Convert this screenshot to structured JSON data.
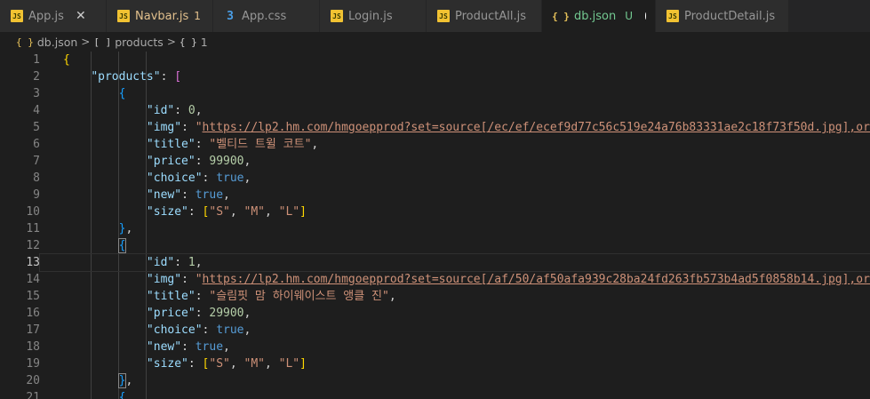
{
  "tabs": [
    {
      "name": "App.js",
      "type": "js",
      "badge": "",
      "close": "✕",
      "state": ""
    },
    {
      "name": "Navbar.js",
      "type": "js",
      "badge": "1",
      "close": "",
      "state": "mod"
    },
    {
      "name": "App.css",
      "type": "css",
      "badge": "",
      "close": "",
      "state": ""
    },
    {
      "name": "Login.js",
      "type": "js",
      "badge": "",
      "close": "",
      "state": ""
    },
    {
      "name": "ProductAll.js",
      "type": "js",
      "badge": "",
      "close": "",
      "state": ""
    },
    {
      "name": "db.json",
      "type": "json",
      "badge": "U",
      "close": "",
      "state": "untracked"
    },
    {
      "name": "ProductDetail.js",
      "type": "js",
      "badge": "",
      "close": "",
      "state": ""
    }
  ],
  "tab_icons": {
    "js": "JS",
    "css": "3",
    "json": "{ }"
  },
  "breadcrumb": {
    "file_icon": "{ }",
    "file": "db.json",
    "sep": ">",
    "array_icon": "[ ]",
    "array": "products",
    "object_icon": "{ }",
    "object": "1"
  },
  "editor": {
    "lines": [
      {
        "n": "1",
        "code": [
          [
            "{",
            "b1"
          ]
        ]
      },
      {
        "n": "2",
        "code": [
          [
            "    ",
            ""
          ],
          [
            "\"products\"",
            "key"
          ],
          [
            ": ",
            "punc"
          ],
          [
            "[",
            "b2"
          ]
        ]
      },
      {
        "n": "3",
        "code": [
          [
            "        ",
            ""
          ],
          [
            "{",
            "b3"
          ]
        ]
      },
      {
        "n": "4",
        "code": [
          [
            "            ",
            ""
          ],
          [
            "\"id\"",
            "key"
          ],
          [
            ": ",
            "punc"
          ],
          [
            "0",
            "num"
          ],
          [
            ",",
            "punc"
          ]
        ]
      },
      {
        "n": "5",
        "code": [
          [
            "            ",
            ""
          ],
          [
            "\"img\"",
            "key"
          ],
          [
            ": ",
            "punc"
          ],
          [
            "\"",
            "str"
          ],
          [
            "https://lp2.hm.com/hmgoepprod?set=source[/ec/ef/ecef9d77c56c519e24a76b83331ae2c18f73f50d.jpg],orig",
            "url"
          ]
        ]
      },
      {
        "n": "6",
        "code": [
          [
            "            ",
            ""
          ],
          [
            "\"title\"",
            "key"
          ],
          [
            ": ",
            "punc"
          ],
          [
            "\"벨티드 트윌 코트\"",
            "str"
          ],
          [
            ",",
            "punc"
          ]
        ]
      },
      {
        "n": "7",
        "code": [
          [
            "            ",
            ""
          ],
          [
            "\"price\"",
            "key"
          ],
          [
            ": ",
            "punc"
          ],
          [
            "99900",
            "num"
          ],
          [
            ",",
            "punc"
          ]
        ]
      },
      {
        "n": "8",
        "code": [
          [
            "            ",
            ""
          ],
          [
            "\"choice\"",
            "key"
          ],
          [
            ": ",
            "punc"
          ],
          [
            "true",
            "bool"
          ],
          [
            ",",
            "punc"
          ]
        ]
      },
      {
        "n": "9",
        "code": [
          [
            "            ",
            ""
          ],
          [
            "\"new\"",
            "key"
          ],
          [
            ": ",
            "punc"
          ],
          [
            "true",
            "bool"
          ],
          [
            ",",
            "punc"
          ]
        ]
      },
      {
        "n": "10",
        "code": [
          [
            "            ",
            ""
          ],
          [
            "\"size\"",
            "key"
          ],
          [
            ": ",
            "punc"
          ],
          [
            "[",
            "b1"
          ],
          [
            "\"S\"",
            "str"
          ],
          [
            ", ",
            "punc"
          ],
          [
            "\"M\"",
            "str"
          ],
          [
            ", ",
            "punc"
          ],
          [
            "\"L\"",
            "str"
          ],
          [
            "]",
            "b1"
          ]
        ]
      },
      {
        "n": "11",
        "code": [
          [
            "        ",
            ""
          ],
          [
            "}",
            "b3"
          ],
          [
            ",",
            "punc"
          ]
        ]
      },
      {
        "n": "12",
        "code": [
          [
            "        ",
            ""
          ],
          [
            "{",
            "b3 bbox"
          ]
        ]
      },
      {
        "n": "13",
        "code": [
          [
            "            ",
            ""
          ],
          [
            "\"id\"",
            "key"
          ],
          [
            ": ",
            "punc"
          ],
          [
            "1",
            "num"
          ],
          [
            ",",
            "punc"
          ]
        ],
        "current": true
      },
      {
        "n": "14",
        "code": [
          [
            "            ",
            ""
          ],
          [
            "\"img\"",
            "key"
          ],
          [
            ": ",
            "punc"
          ],
          [
            "\"",
            "str"
          ],
          [
            "https://lp2.hm.com/hmgoepprod?set=source[/af/50/af50afa939c28ba24fd263fb573b4ad5f0858b14.jpg],orig",
            "url"
          ]
        ]
      },
      {
        "n": "15",
        "code": [
          [
            "            ",
            ""
          ],
          [
            "\"title\"",
            "key"
          ],
          [
            ": ",
            "punc"
          ],
          [
            "\"슬림핏 맘 하이웨이스트 앵클 진\"",
            "str"
          ],
          [
            ",",
            "punc"
          ]
        ]
      },
      {
        "n": "16",
        "code": [
          [
            "            ",
            ""
          ],
          [
            "\"price\"",
            "key"
          ],
          [
            ": ",
            "punc"
          ],
          [
            "29900",
            "num"
          ],
          [
            ",",
            "punc"
          ]
        ]
      },
      {
        "n": "17",
        "code": [
          [
            "            ",
            ""
          ],
          [
            "\"choice\"",
            "key"
          ],
          [
            ": ",
            "punc"
          ],
          [
            "true",
            "bool"
          ],
          [
            ",",
            "punc"
          ]
        ]
      },
      {
        "n": "18",
        "code": [
          [
            "            ",
            ""
          ],
          [
            "\"new\"",
            "key"
          ],
          [
            ": ",
            "punc"
          ],
          [
            "true",
            "bool"
          ],
          [
            ",",
            "punc"
          ]
        ]
      },
      {
        "n": "19",
        "code": [
          [
            "            ",
            ""
          ],
          [
            "\"size\"",
            "key"
          ],
          [
            ": ",
            "punc"
          ],
          [
            "[",
            "b1"
          ],
          [
            "\"S\"",
            "str"
          ],
          [
            ", ",
            "punc"
          ],
          [
            "\"M\"",
            "str"
          ],
          [
            ", ",
            "punc"
          ],
          [
            "\"L\"",
            "str"
          ],
          [
            "]",
            "b1"
          ]
        ]
      },
      {
        "n": "20",
        "code": [
          [
            "        ",
            ""
          ],
          [
            "}",
            "b3 bbox"
          ],
          [
            ",",
            "punc"
          ]
        ]
      },
      {
        "n": "21",
        "code": [
          [
            "        ",
            ""
          ],
          [
            "{",
            "b3"
          ]
        ]
      }
    ]
  }
}
